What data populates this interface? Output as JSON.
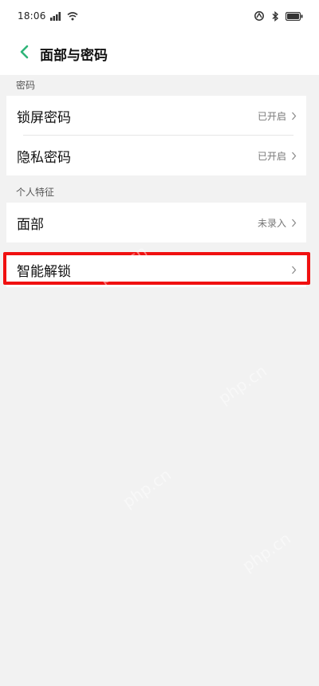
{
  "status_bar": {
    "time": "18:06",
    "colors": {
      "icon": "#333333"
    }
  },
  "header": {
    "title": "面部与密码",
    "back_icon": "chevron-left-icon",
    "accent": "#2fb579"
  },
  "sections": [
    {
      "title": "密码",
      "items": [
        {
          "label": "锁屏密码",
          "status": "已开启"
        },
        {
          "label": "隐私密码",
          "status": "已开启"
        }
      ]
    },
    {
      "title": "个人特征",
      "items": [
        {
          "label": "面部",
          "status": "未录入"
        }
      ]
    },
    {
      "title": "",
      "items": [
        {
          "label": "智能解锁",
          "status": ""
        }
      ]
    }
  ],
  "highlight": {
    "color": "#f01010",
    "target": "智能解锁"
  },
  "watermark": "php.cn"
}
